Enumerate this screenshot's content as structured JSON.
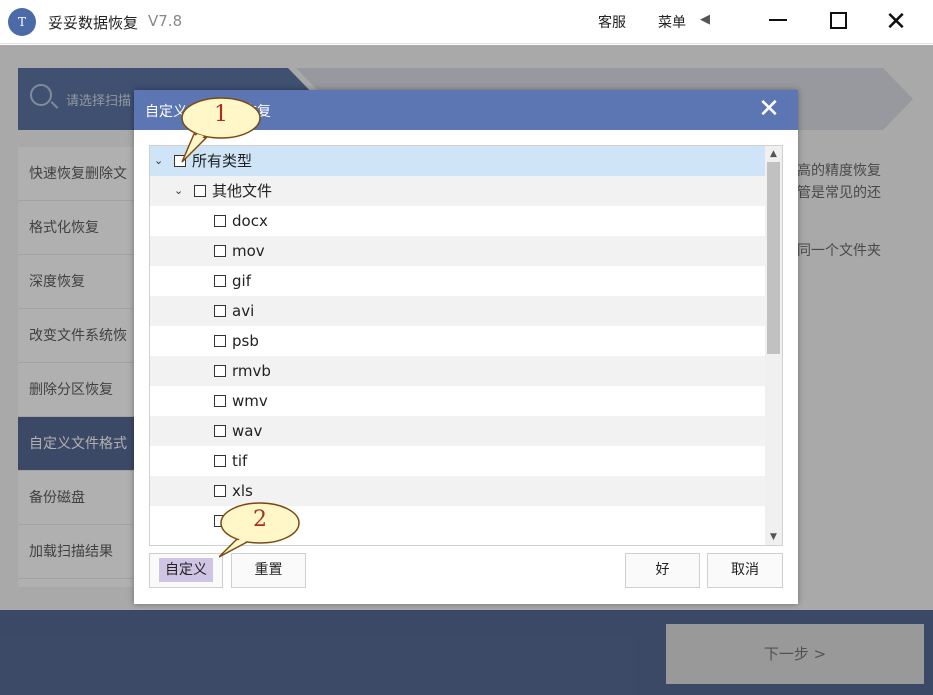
{
  "app": {
    "logo_text": "T",
    "title": "妥妥数据恢复",
    "version": "V7.8",
    "service_label": "客服",
    "menu_label": "菜单",
    "menu_arrow": "◀",
    "min_icon": "minimize-icon",
    "max_icon": "maximize-icon",
    "close_symbol": "✕"
  },
  "steps": {
    "step1_label": "请选择扫描"
  },
  "sidebar": {
    "items": [
      {
        "label": "快速恢复删除文"
      },
      {
        "label": "格式化恢复"
      },
      {
        "label": "深度恢复"
      },
      {
        "label": "改变文件系统恢"
      },
      {
        "label": "删除分区恢复"
      },
      {
        "label": "自定义文件格式"
      },
      {
        "label": "备份磁盘"
      },
      {
        "label": "加载扫描结果"
      }
    ],
    "active_index": 5
  },
  "description": {
    "line1": "高的精度恢复",
    "line2": "管是常见的还",
    "line3": "同一个文件夹"
  },
  "next_button": "下一步 >",
  "dialog": {
    "title": "自定义文件格式恢复",
    "close_symbol": "✕",
    "tree": [
      {
        "label": "所有类型",
        "level": 0,
        "expander": "⌄"
      },
      {
        "label": "其他文件",
        "level": 1,
        "expander": "⌄"
      },
      {
        "label": "docx",
        "level": 2
      },
      {
        "label": "mov",
        "level": 2
      },
      {
        "label": "gif",
        "level": 2
      },
      {
        "label": "avi",
        "level": 2
      },
      {
        "label": "psb",
        "level": 2
      },
      {
        "label": "rmvb",
        "level": 2
      },
      {
        "label": "wmv",
        "level": 2
      },
      {
        "label": "wav",
        "level": 2
      },
      {
        "label": "tif",
        "level": 2
      },
      {
        "label": "xls",
        "level": 2
      }
    ],
    "buttons": {
      "custom": "自定义",
      "reset": "重置",
      "ok": "好",
      "cancel": "取消"
    },
    "scroll_up": "▲",
    "scroll_down": "▼"
  },
  "callouts": {
    "first": "1",
    "second": "2",
    "color": "#fff7c8"
  },
  "colors": {
    "dialog_header": "#5b76b2",
    "sidebar_active": "#2c4479",
    "selected_row": "#cfe5f7"
  }
}
